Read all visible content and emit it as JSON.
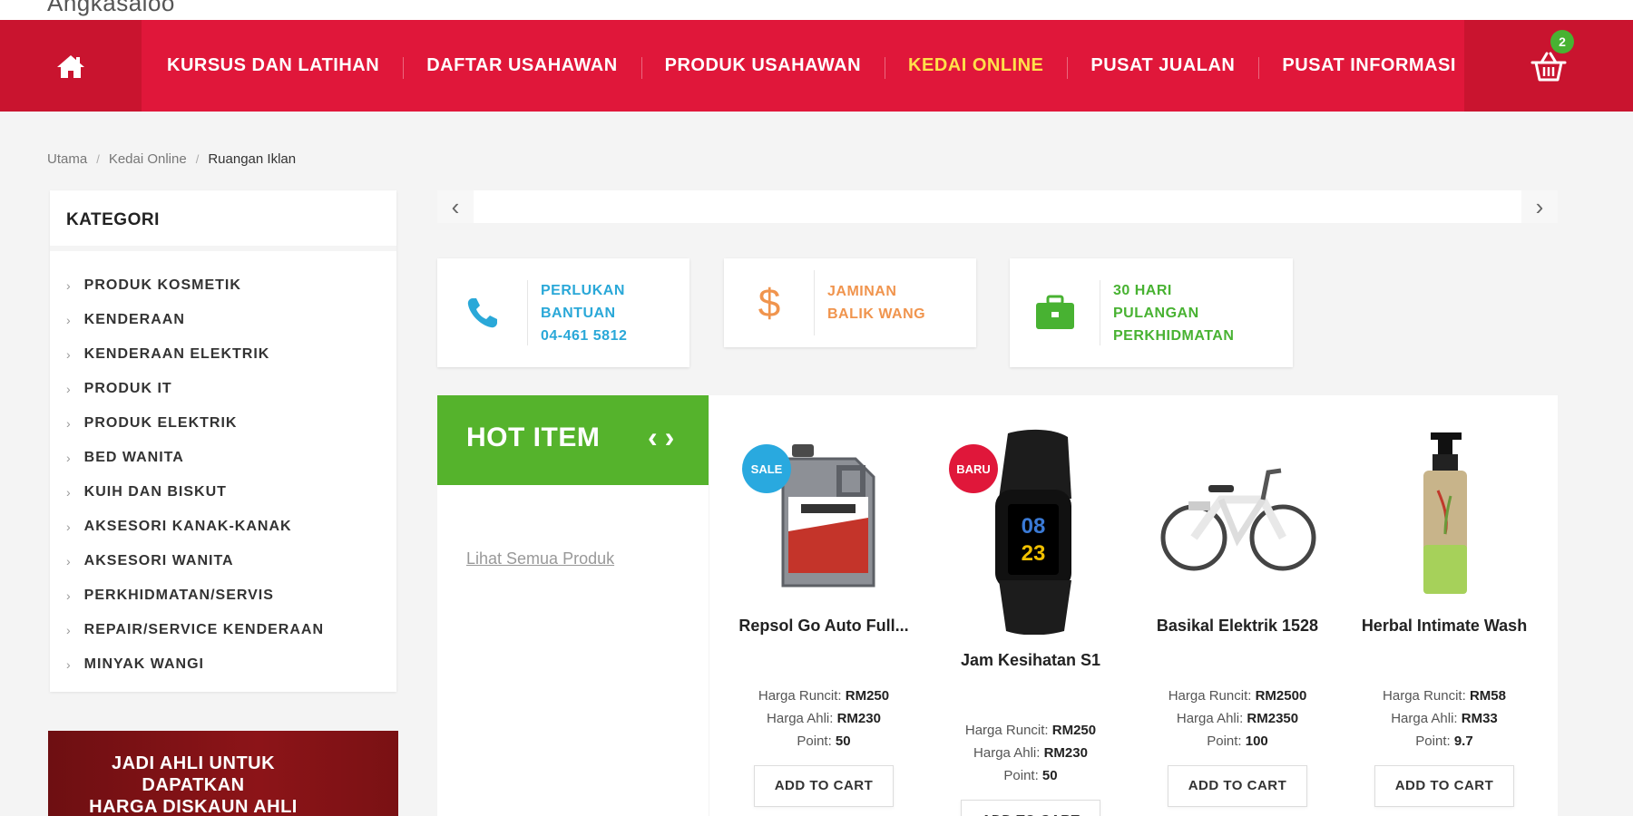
{
  "site": {
    "name": "Angkasaloo"
  },
  "nav": {
    "items": [
      {
        "label": "KURSUS DAN LATIHAN",
        "active": false
      },
      {
        "label": "DAFTAR USAHAWAN",
        "active": false
      },
      {
        "label": "PRODUK USAHAWAN",
        "active": false
      },
      {
        "label": "KEDAI ONLINE",
        "active": true
      },
      {
        "label": "PUSAT JUALAN",
        "active": false
      },
      {
        "label": "PUSAT INFORMASI",
        "active": false
      }
    ],
    "cart_count": "2",
    "active_color": "#ffe14a",
    "bar_color": "#e0173a"
  },
  "breadcrumb": {
    "home": "Utama",
    "section": "Kedai Online",
    "current": "Ruangan Iklan"
  },
  "sidebar": {
    "title": "KATEGORI",
    "categories": [
      "PRODUK KOSMETIK",
      "KENDERAAN",
      "KENDERAAN ELEKTRIK",
      "PRODUK IT",
      "PRODUK ELEKTRIK",
      "BED WANITA",
      "KUIH DAN BISKUT",
      "AKSESORI KANAK-KANAK",
      "AKSESORI WANITA",
      "PERKHIDMATAN/SERVIS",
      "REPAIR/SERVICE KENDERAAN",
      "MINYAK WANGI"
    ],
    "banner": {
      "line1": "JADI AHLI UNTUK",
      "line2": "DAPATKAN",
      "line3": "HARGA DISKAUN AHLI"
    }
  },
  "features": [
    {
      "line1": "PERLUKAN",
      "line2": "BANTUAN",
      "line3": "04-461 5812",
      "icon": "phone-icon",
      "color": "#2aa8d8"
    },
    {
      "line1": "JAMINAN",
      "line2": "BALIK WANG",
      "icon": "dollar-icon",
      "color": "#f0944d"
    },
    {
      "line1": "30 HARI",
      "line2": "PULANGAN",
      "line3": "PERKHIDMATAN",
      "icon": "briefcase-icon",
      "color": "#48b232"
    }
  ],
  "hot": {
    "title": "HOT ITEM",
    "prev": "‹",
    "next": "›",
    "see_all": "Lihat Semua Produk",
    "products": [
      {
        "name": "Repsol Go Auto Full...",
        "badge": "SALE",
        "retail_label": "Harga Runcit:",
        "retail": "RM250",
        "member_label": "Harga Ahli:",
        "member": "RM230",
        "point_label": "Point:",
        "point": "50",
        "button": "ADD TO CART"
      },
      {
        "name": "Jam Kesihatan S1",
        "badge": "BARU",
        "retail_label": "Harga Runcit:",
        "retail": "RM250",
        "member_label": "Harga Ahli:",
        "member": "RM230",
        "point_label": "Point:",
        "point": "50",
        "button": "ADD TO CART"
      },
      {
        "name": "Basikal Elektrik 1528",
        "badge": "",
        "retail_label": "Harga Runcit:",
        "retail": "RM2500",
        "member_label": "Harga Ahli:",
        "member": "RM2350",
        "point_label": "Point:",
        "point": "100",
        "button": "ADD TO CART"
      },
      {
        "name": "Herbal Intimate Wash",
        "badge": "",
        "retail_label": "Harga Runcit:",
        "retail": "RM58",
        "member_label": "Harga Ahli:",
        "member": "RM33",
        "point_label": "Point:",
        "point": "9.7",
        "button": "ADD TO CART"
      }
    ]
  },
  "slider": {
    "prev": "‹",
    "next": "›"
  }
}
